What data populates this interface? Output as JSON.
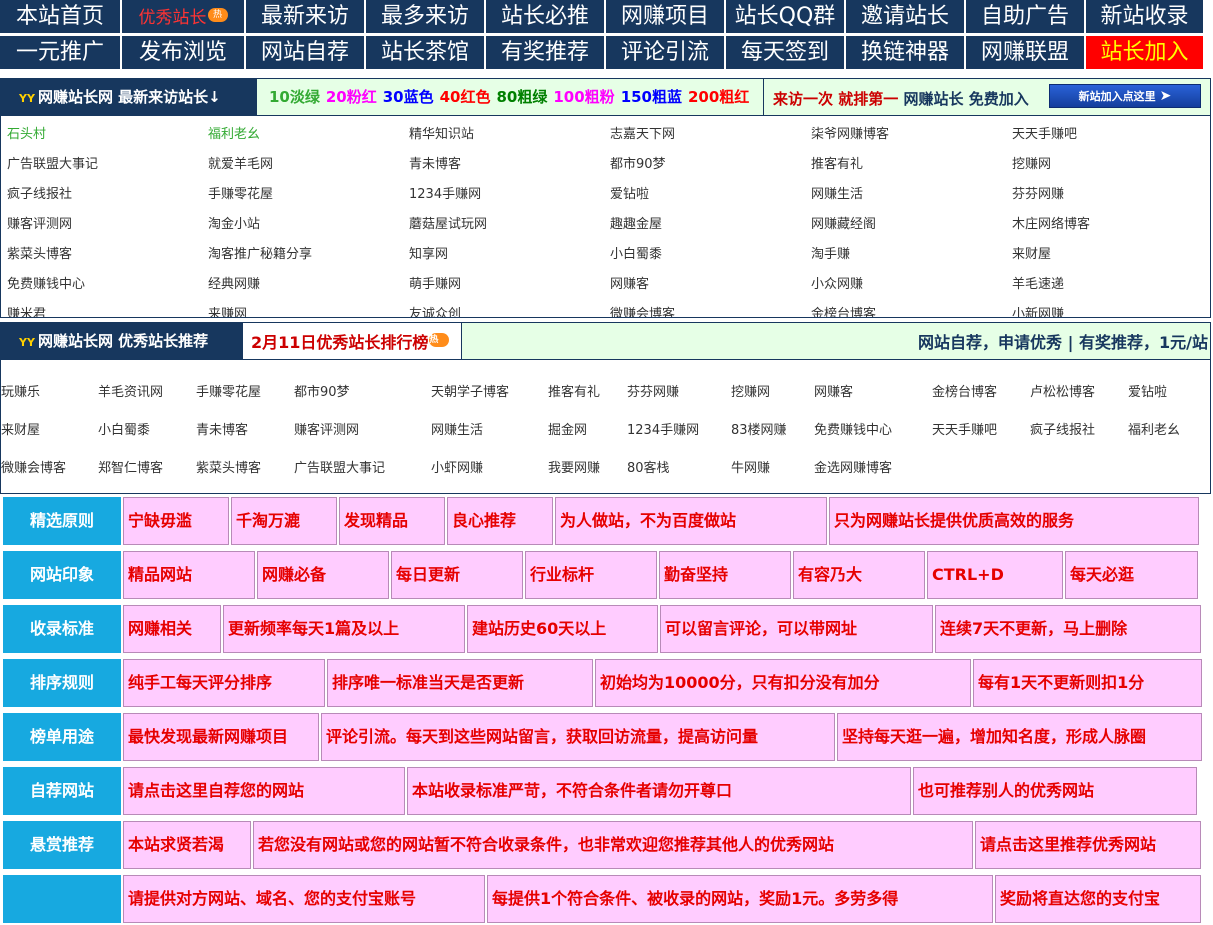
{
  "nav": {
    "row1": [
      "本站首页",
      "优秀站长",
      "最新来访",
      "最多来访",
      "站长必推",
      "网赚项目",
      "站长QQ群",
      "邀请站长",
      "自助广告",
      "新站收录"
    ],
    "row1_badge": "热",
    "row2": [
      "一元推广",
      "发布浏览",
      "网站自荐",
      "站长茶馆",
      "有奖推荐",
      "评论引流",
      "每天签到",
      "换链神器",
      "网赚联盟",
      "站长加入"
    ]
  },
  "latest": {
    "title": "网赚站长网 最新来访站长↓",
    "logo": "YY",
    "legend": [
      {
        "text": "10淡绿",
        "color": "#33aa33"
      },
      {
        "text": "20粉红",
        "color": "#ff00ff"
      },
      {
        "text": "30蓝色",
        "color": "#0000ff"
      },
      {
        "text": "40红色",
        "color": "#ff0000"
      },
      {
        "text": "80粗绿",
        "color": "#008000"
      },
      {
        "text": "100粗粉",
        "color": "#ff00ff"
      },
      {
        "text": "150粗蓝",
        "color": "#0000ff"
      },
      {
        "text": "200粗红",
        "color": "#ff0000"
      }
    ],
    "join_text_red": "来访一次 就排第一",
    "join_text_blue": "网赚站长 免费加入",
    "join_button": "新站加入点这里",
    "sites": [
      [
        "石头村",
        "福利老幺",
        "精华知识站",
        "志嘉天下网",
        "柒爷网赚博客",
        "天天手赚吧"
      ],
      [
        "广告联盟大事记",
        "就爱羊毛网",
        "青未博客",
        "都市90梦",
        "推客有礼",
        "挖赚网"
      ],
      [
        "疯子线报社",
        "手赚零花屋",
        "1234手赚网",
        "爱钻啦",
        "网赚生活",
        "芬芬网赚"
      ],
      [
        "赚客评测网",
        "淘金小站",
        "蘑菇屋试玩网",
        "趣趣金屋",
        "网赚藏经阁",
        "木庄网络博客"
      ],
      [
        "紫菜头博客",
        "淘客推广秘籍分享",
        "知享网",
        "小白蜀黍",
        "淘手赚",
        "来财屋"
      ],
      [
        "免费赚钱中心",
        "经典网赚",
        "萌手赚网",
        "网赚客",
        "小众网赚",
        "羊毛速递"
      ],
      [
        "赚米君",
        "来赚网",
        "友诚众创",
        "微赚会博客",
        "金榜台博客",
        "小新网赚"
      ]
    ],
    "site_colors": {
      "0-0": "#33aa33",
      "0-1": "#33aa33"
    }
  },
  "recommend": {
    "title": "网赚站长网 优秀站长推荐",
    "logo": "YY",
    "date_text": "2月11日优秀站长排行榜",
    "date_badge": "热",
    "right_text": "网站自荐，申请优秀 | 有奖推荐，1元/站",
    "rows": [
      [
        "玩赚乐",
        "羊毛资讯网",
        "手赚零花屋",
        "都市90梦",
        "天朝学子博客",
        "推客有礼",
        "芬芬网赚",
        "挖赚网",
        "网赚客",
        "金榜台博客",
        "卢松松博客",
        "爱钻啦"
      ],
      [
        "来财屋",
        "小白蜀黍",
        "青未博客",
        "赚客评测网",
        "网赚生活",
        "掘金网",
        "1234手赚网",
        "83楼网赚",
        "免费赚钱中心",
        "天天手赚吧",
        "疯子线报社",
        "福利老幺"
      ],
      [
        "微赚会博客",
        "郑智仁博客",
        "紫菜头博客",
        "广告联盟大事记",
        "小虾网赚",
        "我要网赚",
        "80客栈",
        "牛网赚",
        "金选网赚博客"
      ]
    ]
  },
  "rules": [
    {
      "label": "精选原则",
      "cells": [
        "宁缺毋滥",
        "千淘万漉",
        "发现精品",
        "良心推荐",
        "为人做站，不为百度做站",
        "只为网赚站长提供优质高效的服务"
      ]
    },
    {
      "label": "网站印象",
      "cells": [
        "精品网站",
        "网赚必备",
        "每日更新",
        "行业标杆",
        "勤奋坚持",
        "有容乃大",
        "CTRL+D",
        "每天必逛"
      ]
    },
    {
      "label": "收录标准",
      "cells": [
        "网赚相关",
        "更新频率每天1篇及以上",
        "建站历史60天以上",
        "可以留言评论，可以带网址",
        "连续7天不更新，马上删除"
      ]
    },
    {
      "label": "排序规则",
      "cells": [
        "纯手工每天评分排序",
        "排序唯一标准当天是否更新",
        "初始均为10000分，只有扣分没有加分",
        "每有1天不更新则扣1分"
      ]
    },
    {
      "label": "榜单用途",
      "cells": [
        "最快发现最新网赚项目",
        "评论引流。每天到这些网站留言，获取回访流量，提高访问量",
        "坚持每天逛一遍，增加知名度，形成人脉圈"
      ]
    },
    {
      "label": "自荐网站",
      "cells": [
        "请点击这里自荐您的网站",
        "本站收录标准严苛，不符合条件者请勿开尊口",
        "也可推荐别人的优秀网站"
      ]
    },
    {
      "label": "悬赏推荐",
      "cells": [
        "本站求贤若渴",
        "若您没有网站或您的网站暂不符合收录条件，也非常欢迎您推荐其他人的优秀网站",
        "请点击这里推荐优秀网站"
      ]
    },
    {
      "label": "",
      "cells": [
        "请提供对方网站、域名、您的支付宝账号",
        "每提供1个符合条件、被收录的网站，奖励1元。多劳多得",
        "奖励将直达您的支付宝"
      ]
    }
  ]
}
